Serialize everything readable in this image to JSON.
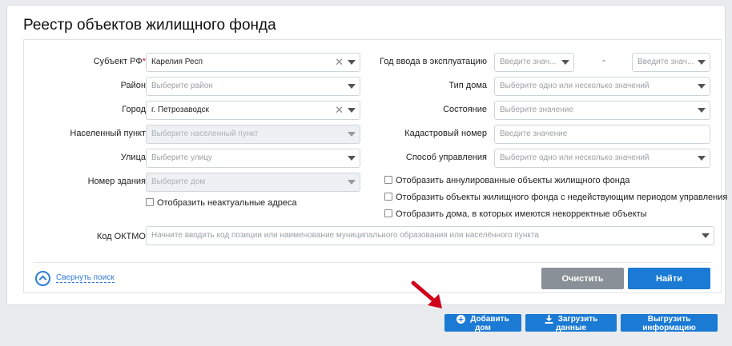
{
  "page": {
    "title": "Реестр объектов жилищного фонда"
  },
  "filters": {
    "subject": {
      "label": "Субъект РФ",
      "required_mark": "*",
      "value": "Карелия Респ"
    },
    "district": {
      "label": "Район",
      "placeholder": "Выберите район"
    },
    "city": {
      "label": "Город",
      "value": "г. Петрозаводск"
    },
    "settlement": {
      "label": "Населенный пункт",
      "placeholder": "Выберите населенный пункт"
    },
    "street": {
      "label": "Улица",
      "placeholder": "Выберите улицу"
    },
    "building": {
      "label": "Номер здания",
      "placeholder": "Выберите дом"
    },
    "show_outdated": {
      "label": "Отобразить неактуальные адреса"
    },
    "year": {
      "label": "Год ввода в эксплуатацию",
      "from_placeholder": "Введите знач...",
      "separator": "-",
      "to_placeholder": "Введите знач..."
    },
    "house_type": {
      "label": "Тип дома",
      "placeholder": "Выберите одно или несколько значений"
    },
    "state": {
      "label": "Состояние",
      "placeholder": "Выберите значение"
    },
    "cadastral": {
      "label": "Кадастровый номер",
      "placeholder": "Введите значение"
    },
    "management": {
      "label": "Способ управления",
      "placeholder": "Выберите одно или несколько значений"
    },
    "checks": [
      {
        "label": "Отобразить аннулированные объекты жилищного фонда"
      },
      {
        "label": "Отобразить объекты жилищного фонда с недействующим периодом управления"
      },
      {
        "label": "Отобразить дома, в которых имеются некорректные объекты"
      }
    ],
    "oktmo": {
      "label": "Код ОКТМО",
      "placeholder": "Начните вводить код позиции или наименование муниципального образования или населённого пункта"
    }
  },
  "actions": {
    "collapse": "Свернуть поиск",
    "clear": "Очистить",
    "find": "Найти"
  },
  "bottom": {
    "add_house": "Добавить дом",
    "upload": "Загрузить данные",
    "export": "Выгрузить информацию"
  },
  "colors": {
    "primary": "#1a7ad4",
    "secondary": "#8a9098",
    "accent_arrow": "#d0021b"
  }
}
